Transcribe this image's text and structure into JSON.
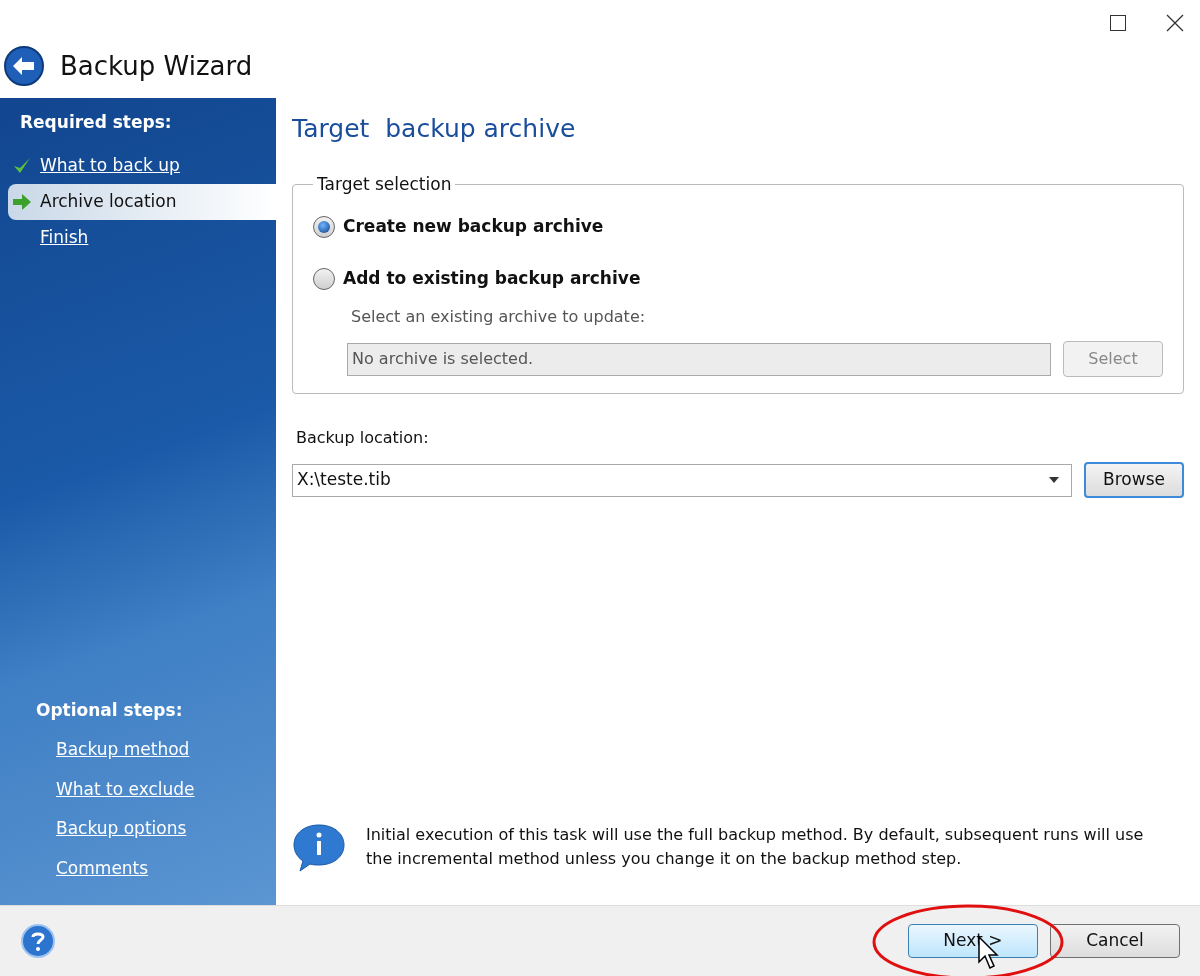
{
  "window": {
    "title": "Backup Wizard"
  },
  "sidebar": {
    "required_heading": "Required steps:",
    "required_steps": [
      {
        "label": "What to back up",
        "kind": "done",
        "selected": false
      },
      {
        "label": "Archive location",
        "kind": "current",
        "selected": true
      },
      {
        "label": "Finish",
        "kind": "todo",
        "selected": false
      }
    ],
    "optional_heading": "Optional steps:",
    "optional_steps": [
      "Backup method",
      "What to exclude",
      "Backup options",
      "Comments"
    ]
  },
  "content": {
    "title": "Target  backup archive",
    "target_selection": {
      "legend": "Target selection",
      "options": [
        {
          "label": "Create new backup archive",
          "selected": true
        },
        {
          "label": "Add to existing backup archive",
          "selected": false
        }
      ],
      "existing_hint": "Select an existing archive to update:",
      "existing_field": {
        "value": "No archive is selected.",
        "disabled": true
      },
      "select_button": {
        "label": "Select",
        "disabled": true
      }
    },
    "backup_location": {
      "label": "Backup location:",
      "value": "X:\\teste.tib",
      "browse_button": "Browse"
    },
    "info_text": "Initial execution of this task will use the full backup method. By default, subsequent runs will use the incremental method unless you change it on the backup method step."
  },
  "footer": {
    "buttons": [
      {
        "label": "Next >",
        "kind": "default"
      },
      {
        "label": "Cancel",
        "kind": "normal"
      }
    ]
  }
}
